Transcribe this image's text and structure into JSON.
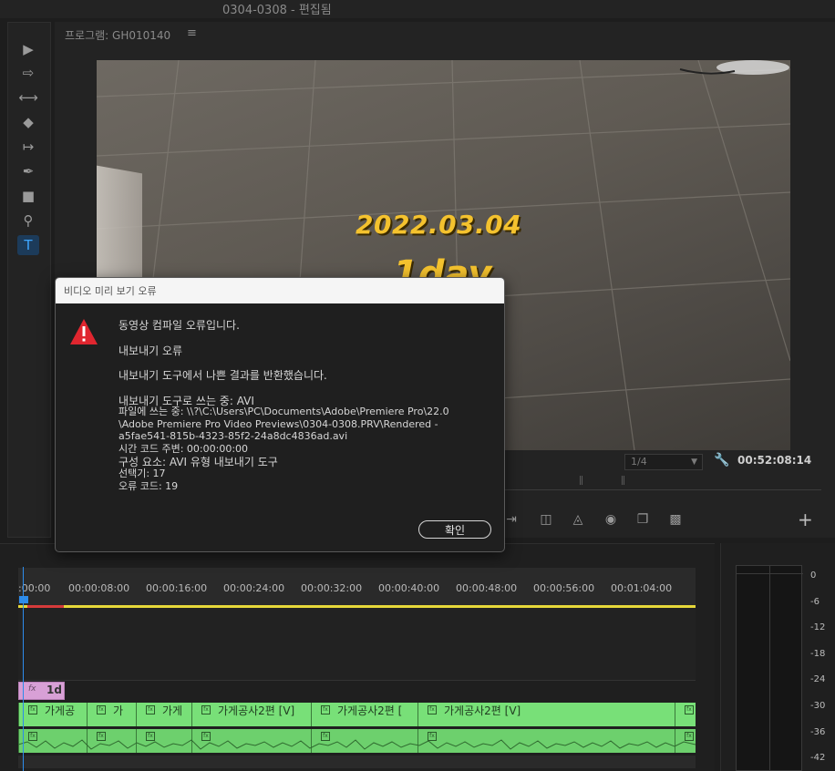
{
  "window": {
    "title": "0304-0308 - 편집됨"
  },
  "program_monitor": {
    "title": "프로그램: GH010140",
    "menu_glyph": "≡",
    "overlay_date": "2022.03.04",
    "overlay_day": "1day",
    "resolution": "1/4",
    "timecode": "00:52:08:14",
    "add_button": "+"
  },
  "tools": {
    "items": [
      "select-tool-icon",
      "track-select-icon",
      "ripple-edit-icon",
      "razor-icon",
      "slip-icon",
      "pen-icon",
      "rectangle-icon",
      "hand-zoom-icon",
      "type-tool-icon"
    ]
  },
  "timeline": {
    "ruler_labels": [
      ":00:00",
      "00:00:08:00",
      "00:00:16:00",
      "00:00:24:00",
      "00:00:32:00",
      "00:00:40:00",
      "00:00:48:00",
      "00:00:56:00",
      "00:01:04:00"
    ],
    "fx_clip_label": "1d",
    "fx_glyph": "fx",
    "video_clips": [
      "가게공",
      "가",
      "가게",
      "가게공사2편 [V]",
      "가게공사2편 [",
      "가게공사2편 [V]",
      ""
    ]
  },
  "audio_meter": {
    "labels": [
      "0",
      "-6",
      "-12",
      "-18",
      "-24",
      "-30",
      "-36",
      "-42"
    ]
  },
  "dialog": {
    "title": "비디오 미리 보기 오류",
    "headline": "동영상 컴파일 오류입니다.",
    "line2": "내보내기 오류",
    "line3": "내보내기 도구에서 나쁜 결과를 반환했습니다.",
    "details": [
      "내보내기 도구로 쓰는 중: AVI",
      "파일에 쓰는 중: \\\\?\\C:\\Users\\PC\\Documents\\Adobe\\Premiere Pro\\22.0",
      "\\Adobe Premiere Pro Video Previews\\0304-0308.PRV\\Rendered -",
      "a5fae541-815b-4323-85f2-24a8dc4836ad.avi",
      "시간 코드 주변: 00:00:00:00",
      "구성 요소: AVI 유형 내보내기 도구",
      "선택기: 17",
      "오류 코드: 19"
    ],
    "ok_label": "확인"
  },
  "colors": {
    "accent": "#2d8ceb",
    "video_track": "#78e078",
    "fx_clip": "#d8a0d6",
    "overlay_text": "#f4c22e",
    "warning": "#e0262f"
  }
}
